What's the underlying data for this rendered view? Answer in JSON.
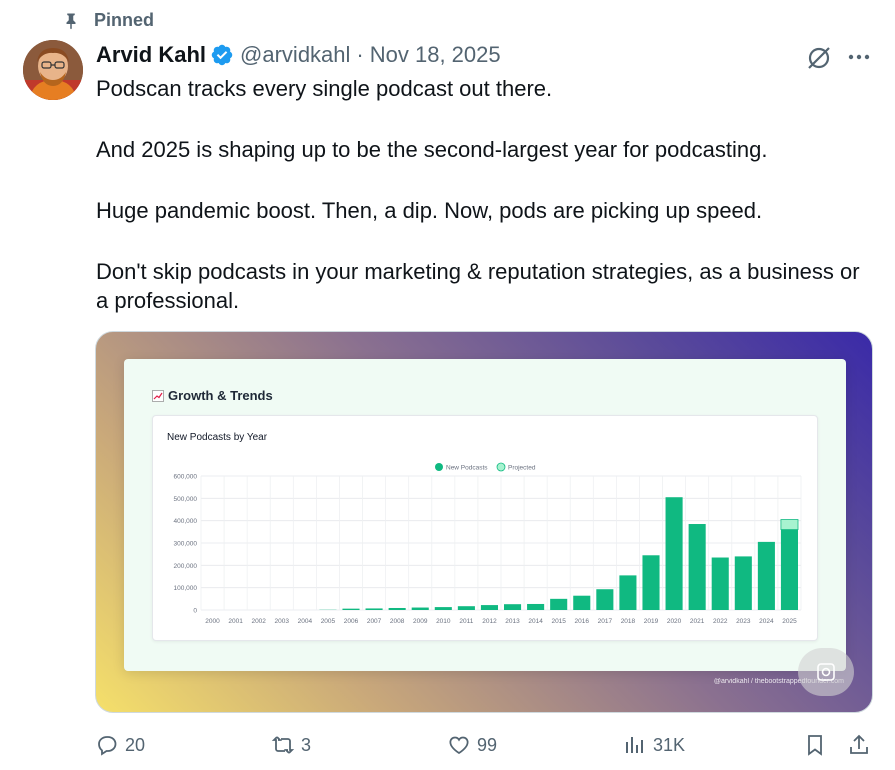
{
  "pinned_label": "Pinned",
  "author": {
    "name": "Arvid Kahl",
    "handle": "@arvidkahl",
    "separator": "·",
    "date": "Nov 18, 2025"
  },
  "tweet_paragraphs": [
    "Podscan tracks every single podcast out there.",
    "And 2025 is shaping up to be the second-largest year for podcasting.",
    "Huge pandemic boost. Then, a dip. Now, pods are picking up speed.",
    "Don't skip podcasts in your marketing & reputation strategies, as a business or a professional."
  ],
  "media": {
    "slide_title": "Growth & Trends",
    "card_title": "New Podcasts by Year",
    "watermark": "@arvidkahl / thebootstrappedfounder.com"
  },
  "chart_data": {
    "type": "bar",
    "title": "New Podcasts by Year",
    "legend": [
      "New Podcasts",
      "Projected"
    ],
    "legend_position": "top-center",
    "categories": [
      "2000",
      "2001",
      "2002",
      "2003",
      "2004",
      "2005",
      "2006",
      "2007",
      "2008",
      "2009",
      "2010",
      "2011",
      "2012",
      "2013",
      "2014",
      "2015",
      "2016",
      "2017",
      "2018",
      "2019",
      "2020",
      "2021",
      "2022",
      "2023",
      "2024",
      "2025"
    ],
    "series": [
      {
        "name": "New Podcasts",
        "values": [
          0,
          0,
          0,
          0,
          0,
          1000,
          6000,
          7000,
          9000,
          11000,
          13000,
          17000,
          22000,
          26000,
          27000,
          50000,
          64000,
          93000,
          155000,
          245000,
          505000,
          385000,
          235000,
          240000,
          305000,
          360000
        ]
      },
      {
        "name": "Projected",
        "values": [
          0,
          0,
          0,
          0,
          0,
          0,
          0,
          0,
          0,
          0,
          0,
          0,
          0,
          0,
          0,
          0,
          0,
          0,
          0,
          0,
          0,
          0,
          0,
          0,
          0,
          45000
        ]
      }
    ],
    "ylim": [
      0,
      600000
    ],
    "yticks": [
      "0",
      "100,000",
      "200,000",
      "300,000",
      "400,000",
      "500,000",
      "600,000"
    ],
    "grid": true,
    "colors": {
      "actual": "#10b981",
      "projected": "#a7f3d0"
    }
  },
  "actions": {
    "replies": "20",
    "reposts": "3",
    "likes": "99",
    "views": "31K"
  },
  "colors": {
    "verified": "#1d9bf0",
    "muted": "#536471"
  }
}
